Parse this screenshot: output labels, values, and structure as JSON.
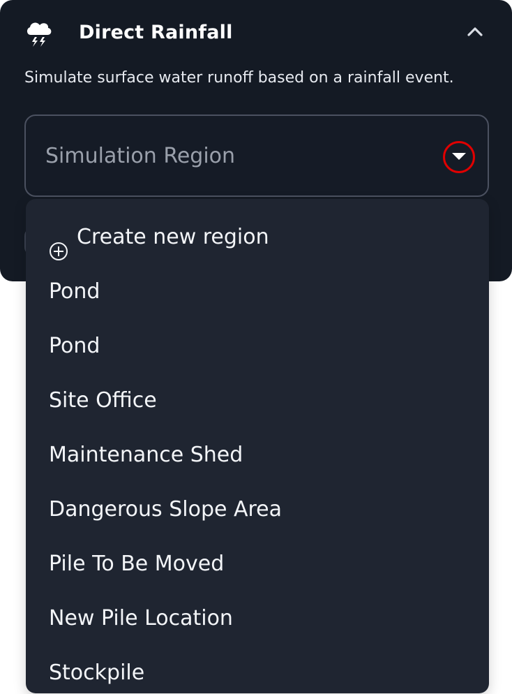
{
  "panel": {
    "title": "Direct Rainfall",
    "description": "Simulate surface water runoff based on a rainfall event.",
    "icon": "rain-cloud-icon",
    "collapse_icon": "chevron-up-icon"
  },
  "select": {
    "placeholder": "Simulation Region",
    "toggle_icon": "caret-down-icon",
    "highlight_color": "#e00000"
  },
  "menu": {
    "create_label": "Create new region",
    "create_icon": "plus-circle-icon",
    "items": [
      "Pond",
      "Pond",
      "Site Office",
      "Maintenance Shed",
      "Dangerous Slope Area",
      "Pile To Be Moved",
      "New Pile Location",
      "Stockpile"
    ]
  },
  "colors": {
    "panel_bg": "#141a24",
    "menu_bg": "#1f2531",
    "text": "#f3f5f8"
  }
}
